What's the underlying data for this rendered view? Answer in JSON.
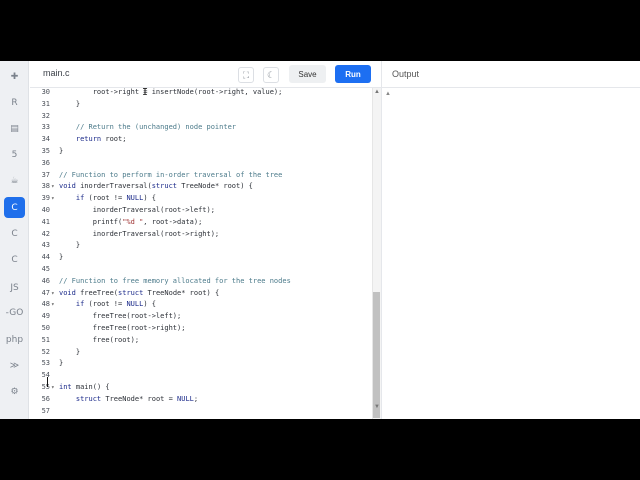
{
  "editor": {
    "file_tab": "main.c",
    "save_label": "Save",
    "run_label": "Run"
  },
  "output": {
    "title": "Output"
  },
  "sidebar": {
    "items": [
      {
        "name": "python",
        "label": ""
      },
      {
        "name": "r",
        "label": ""
      },
      {
        "name": "sql",
        "label": ""
      },
      {
        "name": "html",
        "label": ""
      },
      {
        "name": "java",
        "label": ""
      },
      {
        "name": "c",
        "label": ""
      },
      {
        "name": "cpp",
        "label": ""
      },
      {
        "name": "csharp",
        "label": ""
      },
      {
        "name": "js",
        "label": "JS"
      },
      {
        "name": "go",
        "label": "-GO"
      },
      {
        "name": "php",
        "label": "php"
      },
      {
        "name": "swift",
        "label": ""
      },
      {
        "name": "rust",
        "label": ""
      }
    ],
    "active": "c"
  },
  "code": {
    "lines": [
      {
        "n": "30",
        "fold": "",
        "text": "        root->right = insertNode(root->right, value);",
        "cls": ""
      },
      {
        "n": "31",
        "fold": "",
        "text": "    }",
        "cls": ""
      },
      {
        "n": "32",
        "fold": "",
        "text": "",
        "cls": ""
      },
      {
        "n": "33",
        "fold": "",
        "text": "    // Return the (unchanged) node pointer",
        "cls": "cm"
      },
      {
        "n": "34",
        "fold": "",
        "text": "    return root;",
        "cls": ""
      },
      {
        "n": "35",
        "fold": "",
        "text": "}",
        "cls": ""
      },
      {
        "n": "36",
        "fold": "",
        "text": "",
        "cls": ""
      },
      {
        "n": "37",
        "fold": "",
        "text": "// Function to perform in-order traversal of the tree",
        "cls": "cm"
      },
      {
        "n": "38",
        "fold": "▾",
        "text": "void inorderTraversal(struct TreeNode* root) {",
        "cls": ""
      },
      {
        "n": "39",
        "fold": "▾",
        "text": "    if (root != NULL) {",
        "cls": ""
      },
      {
        "n": "40",
        "fold": "",
        "text": "        inorderTraversal(root->left);",
        "cls": ""
      },
      {
        "n": "41",
        "fold": "",
        "text": "        printf(\"%d \", root->data);",
        "cls": ""
      },
      {
        "n": "42",
        "fold": "",
        "text": "        inorderTraversal(root->right);",
        "cls": ""
      },
      {
        "n": "43",
        "fold": "",
        "text": "    }",
        "cls": ""
      },
      {
        "n": "44",
        "fold": "",
        "text": "}",
        "cls": ""
      },
      {
        "n": "45",
        "fold": "",
        "text": "",
        "cls": ""
      },
      {
        "n": "46",
        "fold": "",
        "text": "// Function to free memory allocated for the tree nodes",
        "cls": "cm"
      },
      {
        "n": "47",
        "fold": "▾",
        "text": "void freeTree(struct TreeNode* root) {",
        "cls": ""
      },
      {
        "n": "48",
        "fold": "▾",
        "text": "    if (root != NULL) {",
        "cls": ""
      },
      {
        "n": "49",
        "fold": "",
        "text": "        freeTree(root->left);",
        "cls": ""
      },
      {
        "n": "50",
        "fold": "",
        "text": "        freeTree(root->right);",
        "cls": ""
      },
      {
        "n": "51",
        "fold": "",
        "text": "        free(root);",
        "cls": ""
      },
      {
        "n": "52",
        "fold": "",
        "text": "    }",
        "cls": ""
      },
      {
        "n": "53",
        "fold": "",
        "text": "}",
        "cls": ""
      },
      {
        "n": "54",
        "fold": "",
        "text": "",
        "cls": ""
      },
      {
        "n": "55",
        "fold": "▾",
        "text": "int main() {",
        "cls": ""
      },
      {
        "n": "56",
        "fold": "",
        "text": "    struct TreeNode* root = NULL;",
        "cls": ""
      },
      {
        "n": "57",
        "fold": "",
        "text": "",
        "cls": ""
      }
    ]
  },
  "colors": {
    "run_button": "#1d6ff2",
    "active_language": "#1f6feb"
  }
}
